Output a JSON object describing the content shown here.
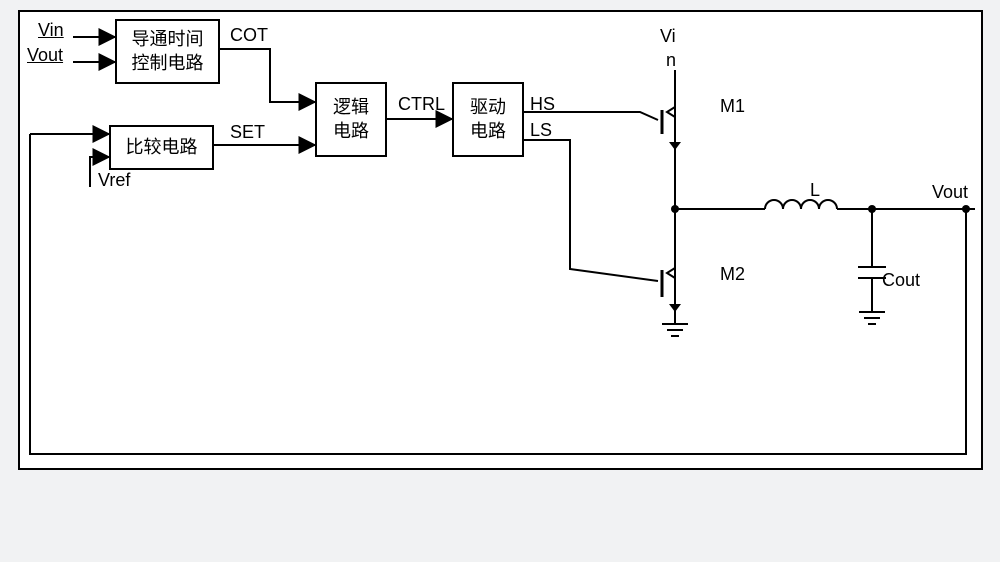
{
  "diagram": {
    "type": "block-diagram",
    "description": "Constant On-Time (COT) buck converter control block diagram"
  },
  "blocks": {
    "ontime_ctrl": "导通时间\n控制电路",
    "compare": "比较电路",
    "logic": "逻辑\n电路",
    "driver": "驱动\n电路"
  },
  "signals": {
    "Vin": "Vin",
    "Vout": "Vout",
    "Vref": "Vref",
    "COT": "COT",
    "SET": "SET",
    "CTRL": "CTRL",
    "HS": "HS",
    "LS": "LS",
    "Vi_top": "Vi",
    "n_suffix": "n",
    "M1": "M1",
    "M2": "M2",
    "L": "L",
    "Cout": "Cout",
    "Vout_right": "Vout"
  }
}
